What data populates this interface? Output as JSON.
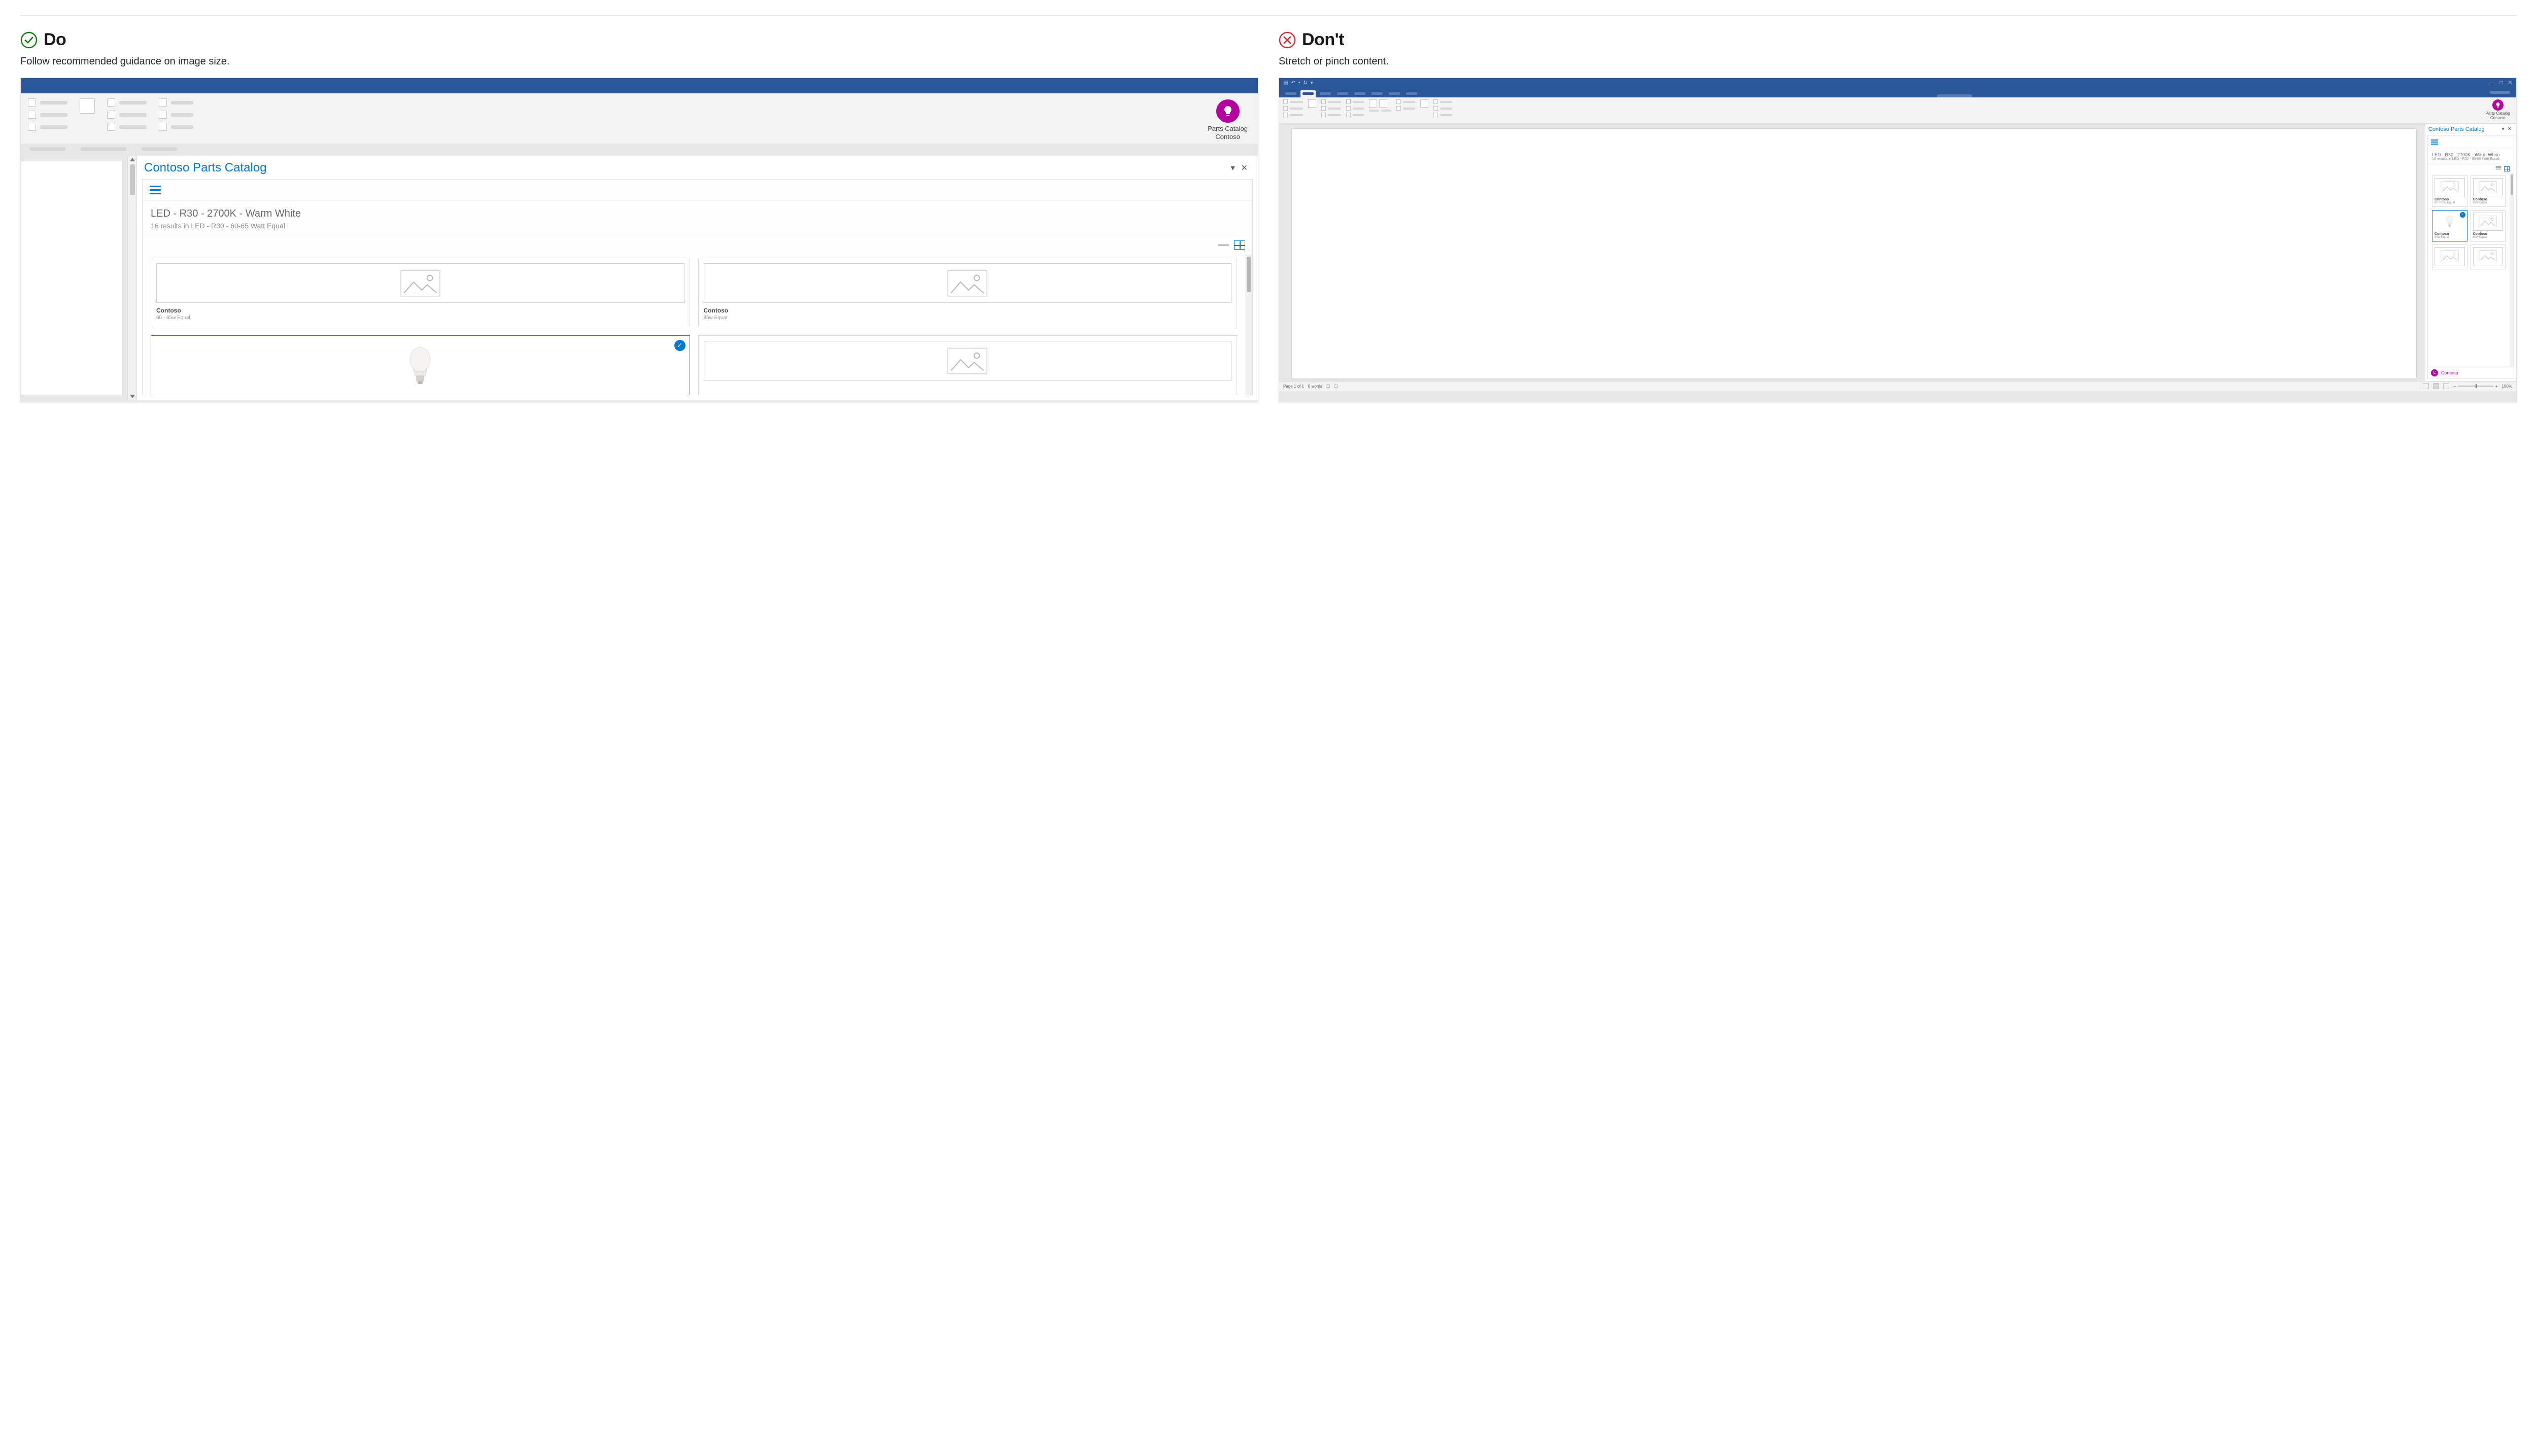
{
  "do": {
    "label": "Do",
    "subtitle": "Follow recommended guidance on image size."
  },
  "dont": {
    "label": "Don't",
    "subtitle": "Stretch or pinch content."
  },
  "addin": {
    "line1": "Parts Catalog",
    "line2": "Contoso"
  },
  "pane": {
    "title": "Contoso Parts Catalog",
    "crumb_title": "LED - R30 - 2700K - Warm White",
    "crumb_sub": "16 results in LED - R30 - 60-65 Watt Equal"
  },
  "cards": [
    {
      "brand": "Contoso",
      "meta": "60 - 65w Equal",
      "selected": false,
      "image": "placeholder"
    },
    {
      "brand": "Contoso",
      "meta": "85w Equal",
      "selected": false,
      "image": "placeholder"
    },
    {
      "brand": "",
      "meta": "",
      "selected": true,
      "image": "bulb"
    },
    {
      "brand": "",
      "meta": "",
      "selected": false,
      "image": "placeholder"
    }
  ],
  "rt_cards": [
    {
      "brand": "Contoso",
      "meta": "60 - 65w Equal",
      "selected": false,
      "image": "placeholder"
    },
    {
      "brand": "Contoso",
      "meta": "85w Equal",
      "selected": false,
      "image": "placeholder"
    },
    {
      "brand": "Contoso",
      "meta": "65w Equal",
      "selected": true,
      "image": "bulb"
    },
    {
      "brand": "Contoso",
      "meta": "85w Equal",
      "selected": false,
      "image": "placeholder"
    },
    {
      "brand": "",
      "meta": "",
      "selected": false,
      "image": "placeholder"
    },
    {
      "brand": "",
      "meta": "",
      "selected": false,
      "image": "placeholder"
    }
  ],
  "persona": {
    "initial": "C",
    "name": "Contoso"
  },
  "status": {
    "page": "Page 1 of 1",
    "words": "0 words",
    "zoom": "100%"
  }
}
